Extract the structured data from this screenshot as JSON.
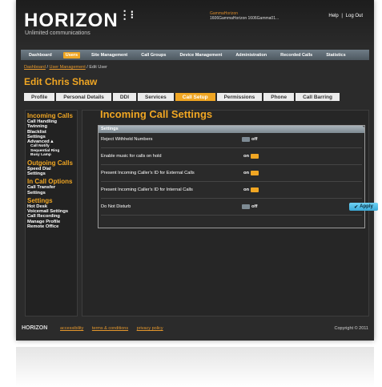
{
  "brand": {
    "name": "HORIZON",
    "tagline": "Unlimited communications"
  },
  "user": {
    "name": "GammaHorizon",
    "account": "1606GammaHorizon 1606Gamma01..."
  },
  "top_links": {
    "help": "Help",
    "separator": "|",
    "logout": "Log Out"
  },
  "nav": {
    "items": [
      {
        "label": "Dashboard",
        "active": false
      },
      {
        "label": "Users",
        "active": true
      },
      {
        "label": "Site Management",
        "active": false
      },
      {
        "label": "Call Groups",
        "active": false
      },
      {
        "label": "Device Management",
        "active": false
      },
      {
        "label": "Administration",
        "active": false
      },
      {
        "label": "Recorded Calls",
        "active": false
      },
      {
        "label": "Statistics",
        "active": false
      }
    ]
  },
  "breadcrumb": {
    "part1": "Dashboard",
    "sep1": " / ",
    "part2": "User Management",
    "sep2": " / ",
    "part3": "Edit User"
  },
  "page": {
    "title": "Edit Chris Shaw"
  },
  "tabs": [
    {
      "label": "Profile",
      "active": false
    },
    {
      "label": "Personal Details",
      "active": false
    },
    {
      "label": "DDI",
      "active": false
    },
    {
      "label": "Services",
      "active": false
    },
    {
      "label": "Call Setup",
      "active": true
    },
    {
      "label": "Permissions",
      "active": false
    },
    {
      "label": "Phone",
      "active": false
    },
    {
      "label": "Call Barring",
      "active": false
    }
  ],
  "sidebar": {
    "incoming": {
      "heading": "Incoming Calls",
      "items": [
        "Call Handling",
        "Twinning",
        "Blacklist",
        "Settings",
        "Advanced ▴"
      ],
      "sub": [
        "Call Notify",
        "Sequential Ring",
        "Busy Lamp"
      ]
    },
    "outgoing": {
      "heading": "Outgoing Calls",
      "items": [
        "Speed Dial",
        "Settings"
      ]
    },
    "incall": {
      "heading": "In Call Options",
      "items": [
        "Call Transfer",
        "Settings"
      ]
    },
    "settings": {
      "heading": "Settings",
      "items": [
        "Hot Desk",
        "Voicemail Settings",
        "Call Recording",
        "Manage Profile",
        "Remote Office"
      ]
    }
  },
  "content": {
    "title": "Incoming Call Settings",
    "panel_heading": "Settings",
    "rows": [
      {
        "label": "Reject Withheld Numbers",
        "state": "off"
      },
      {
        "label": "Enable music for calls on hold",
        "state": "on"
      },
      {
        "label": "Present Incoming Caller's ID for External Calls",
        "state": "on"
      },
      {
        "label": "Present Incoming Caller's ID for Internal Calls",
        "state": "on"
      },
      {
        "label": "Do Not Disturb",
        "state": "off"
      }
    ],
    "apply_label": "Apply",
    "apply_icon": "checkmark-icon"
  },
  "footer": {
    "logo": "HORIZON",
    "links": [
      "accessibility",
      "terms & conditions",
      "privacy policy"
    ],
    "copyright": "Copyright © 2011"
  },
  "colors": {
    "accent": "#f0a623",
    "apply": "#3aa9d6",
    "toggle_off": "#7d8a93",
    "background": "#2b2b2b"
  }
}
